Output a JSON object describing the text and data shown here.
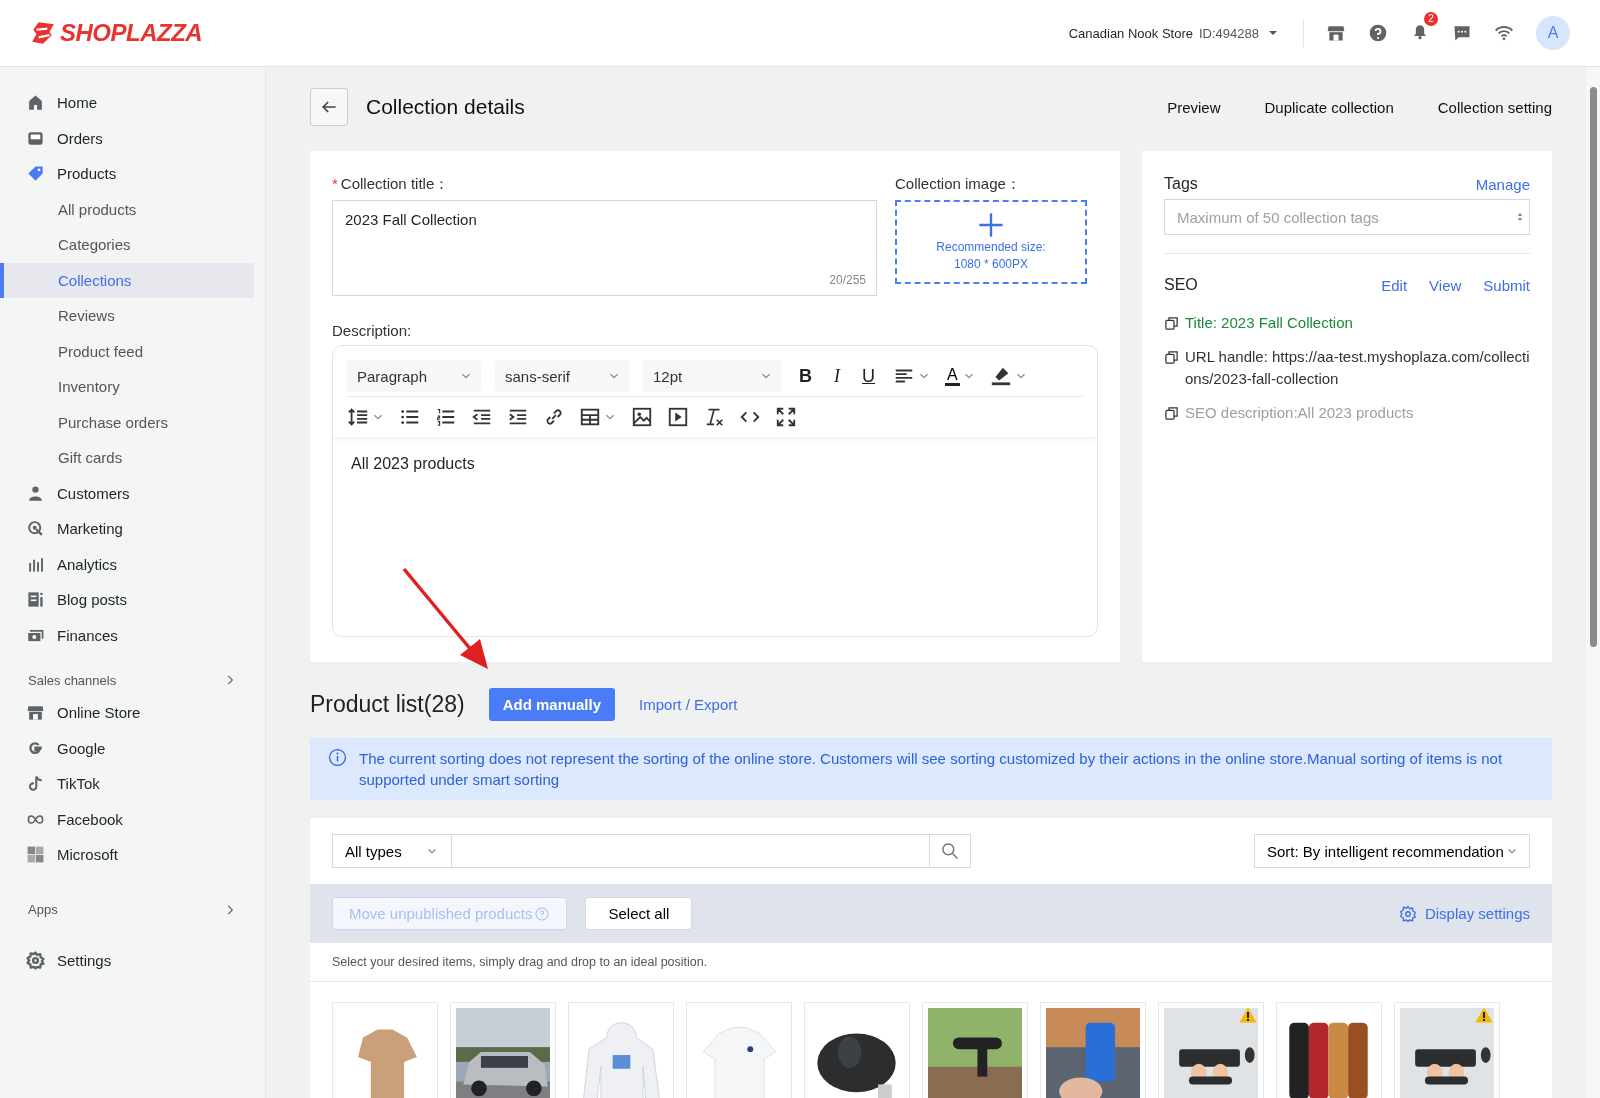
{
  "header": {
    "logo": "SHOPLAZZA",
    "store_name": "Canadian Nook Store",
    "store_id": "ID:494288",
    "notification_count": "2",
    "avatar": "A"
  },
  "sidebar": {
    "main": [
      {
        "label": "Home"
      },
      {
        "label": "Orders"
      },
      {
        "label": "Products",
        "children": [
          {
            "label": "All products",
            "selected": false
          },
          {
            "label": "Categories",
            "selected": false
          },
          {
            "label": "Collections",
            "selected": true
          },
          {
            "label": "Reviews",
            "selected": false
          },
          {
            "label": "Product feed",
            "selected": false
          },
          {
            "label": "Inventory",
            "selected": false
          },
          {
            "label": "Purchase orders",
            "selected": false
          },
          {
            "label": "Gift cards",
            "selected": false
          }
        ]
      },
      {
        "label": "Customers"
      },
      {
        "label": "Marketing"
      },
      {
        "label": "Analytics"
      },
      {
        "label": "Blog posts"
      },
      {
        "label": "Finances"
      }
    ],
    "sales_channels": {
      "heading": "Sales channels",
      "items": [
        {
          "label": "Online Store"
        },
        {
          "label": "Google"
        },
        {
          "label": "TikTok"
        },
        {
          "label": "Facebook"
        },
        {
          "label": "Microsoft"
        }
      ]
    },
    "apps": {
      "heading": "Apps"
    },
    "settings": {
      "label": "Settings"
    }
  },
  "page": {
    "title": "Collection details",
    "actions": [
      "Preview",
      "Duplicate collection",
      "Collection setting"
    ]
  },
  "form": {
    "title_label": "Collection title：",
    "required_mark": "*",
    "title_value": "2023 Fall Collection",
    "counter": "20/255",
    "image_label": "Collection image：",
    "image_hint": [
      "Recommended size:",
      "1080 * 600PX"
    ],
    "description_label": "Description:",
    "selects": [
      "Paragraph",
      "sans-serif",
      "12pt"
    ],
    "format_buttons": [
      "B",
      "I",
      "U"
    ],
    "font_color_button": "A",
    "content": "All 2023 products"
  },
  "tags": {
    "heading": "Tags",
    "link": "Manage",
    "placeholder": "Maximum of 50 collection tags"
  },
  "seo": {
    "heading": "SEO",
    "links": [
      "Edit",
      "View",
      "Submit"
    ],
    "entries": [
      {
        "kind": "title",
        "text": "Title: 2023 Fall Collection"
      },
      {
        "kind": "url",
        "text": "URL handle: https://aa-test.myshoplaza.com/collections/2023-fall-collection"
      },
      {
        "kind": "description",
        "text": "SEO description:All 2023 products"
      }
    ]
  },
  "product_list": {
    "title": "Product list(28)",
    "add_button": "Add manually",
    "import_link": "Import / Export",
    "notice": "The current sorting does not represent the sorting of the online store. Customers will see sorting customized by their actions in the online store.Manual sorting of items is not supported under smart sorting",
    "type_select": "All types",
    "sort_select": "Sort: By intelligent recommendation",
    "move_button": {
      "label": "Move unpublished products",
      "disabled": true
    },
    "select_all": "Select all",
    "display_settings": "Display settings",
    "hint": "Select your desired items, simply drag and drop to an ideal position.",
    "products": [
      {
        "kind": "picture",
        "warning": false
      },
      {
        "kind": "picture",
        "warning": false
      },
      {
        "kind": "picture",
        "warning": false
      },
      {
        "kind": "picture",
        "warning": false
      },
      {
        "kind": "picture",
        "warning": false
      },
      {
        "kind": "picture",
        "warning": false
      },
      {
        "kind": "picture",
        "warning": false
      },
      {
        "kind": "picture",
        "warning": true
      },
      {
        "kind": "picture",
        "warning": false
      },
      {
        "kind": "picture",
        "warning": true
      }
    ]
  }
}
